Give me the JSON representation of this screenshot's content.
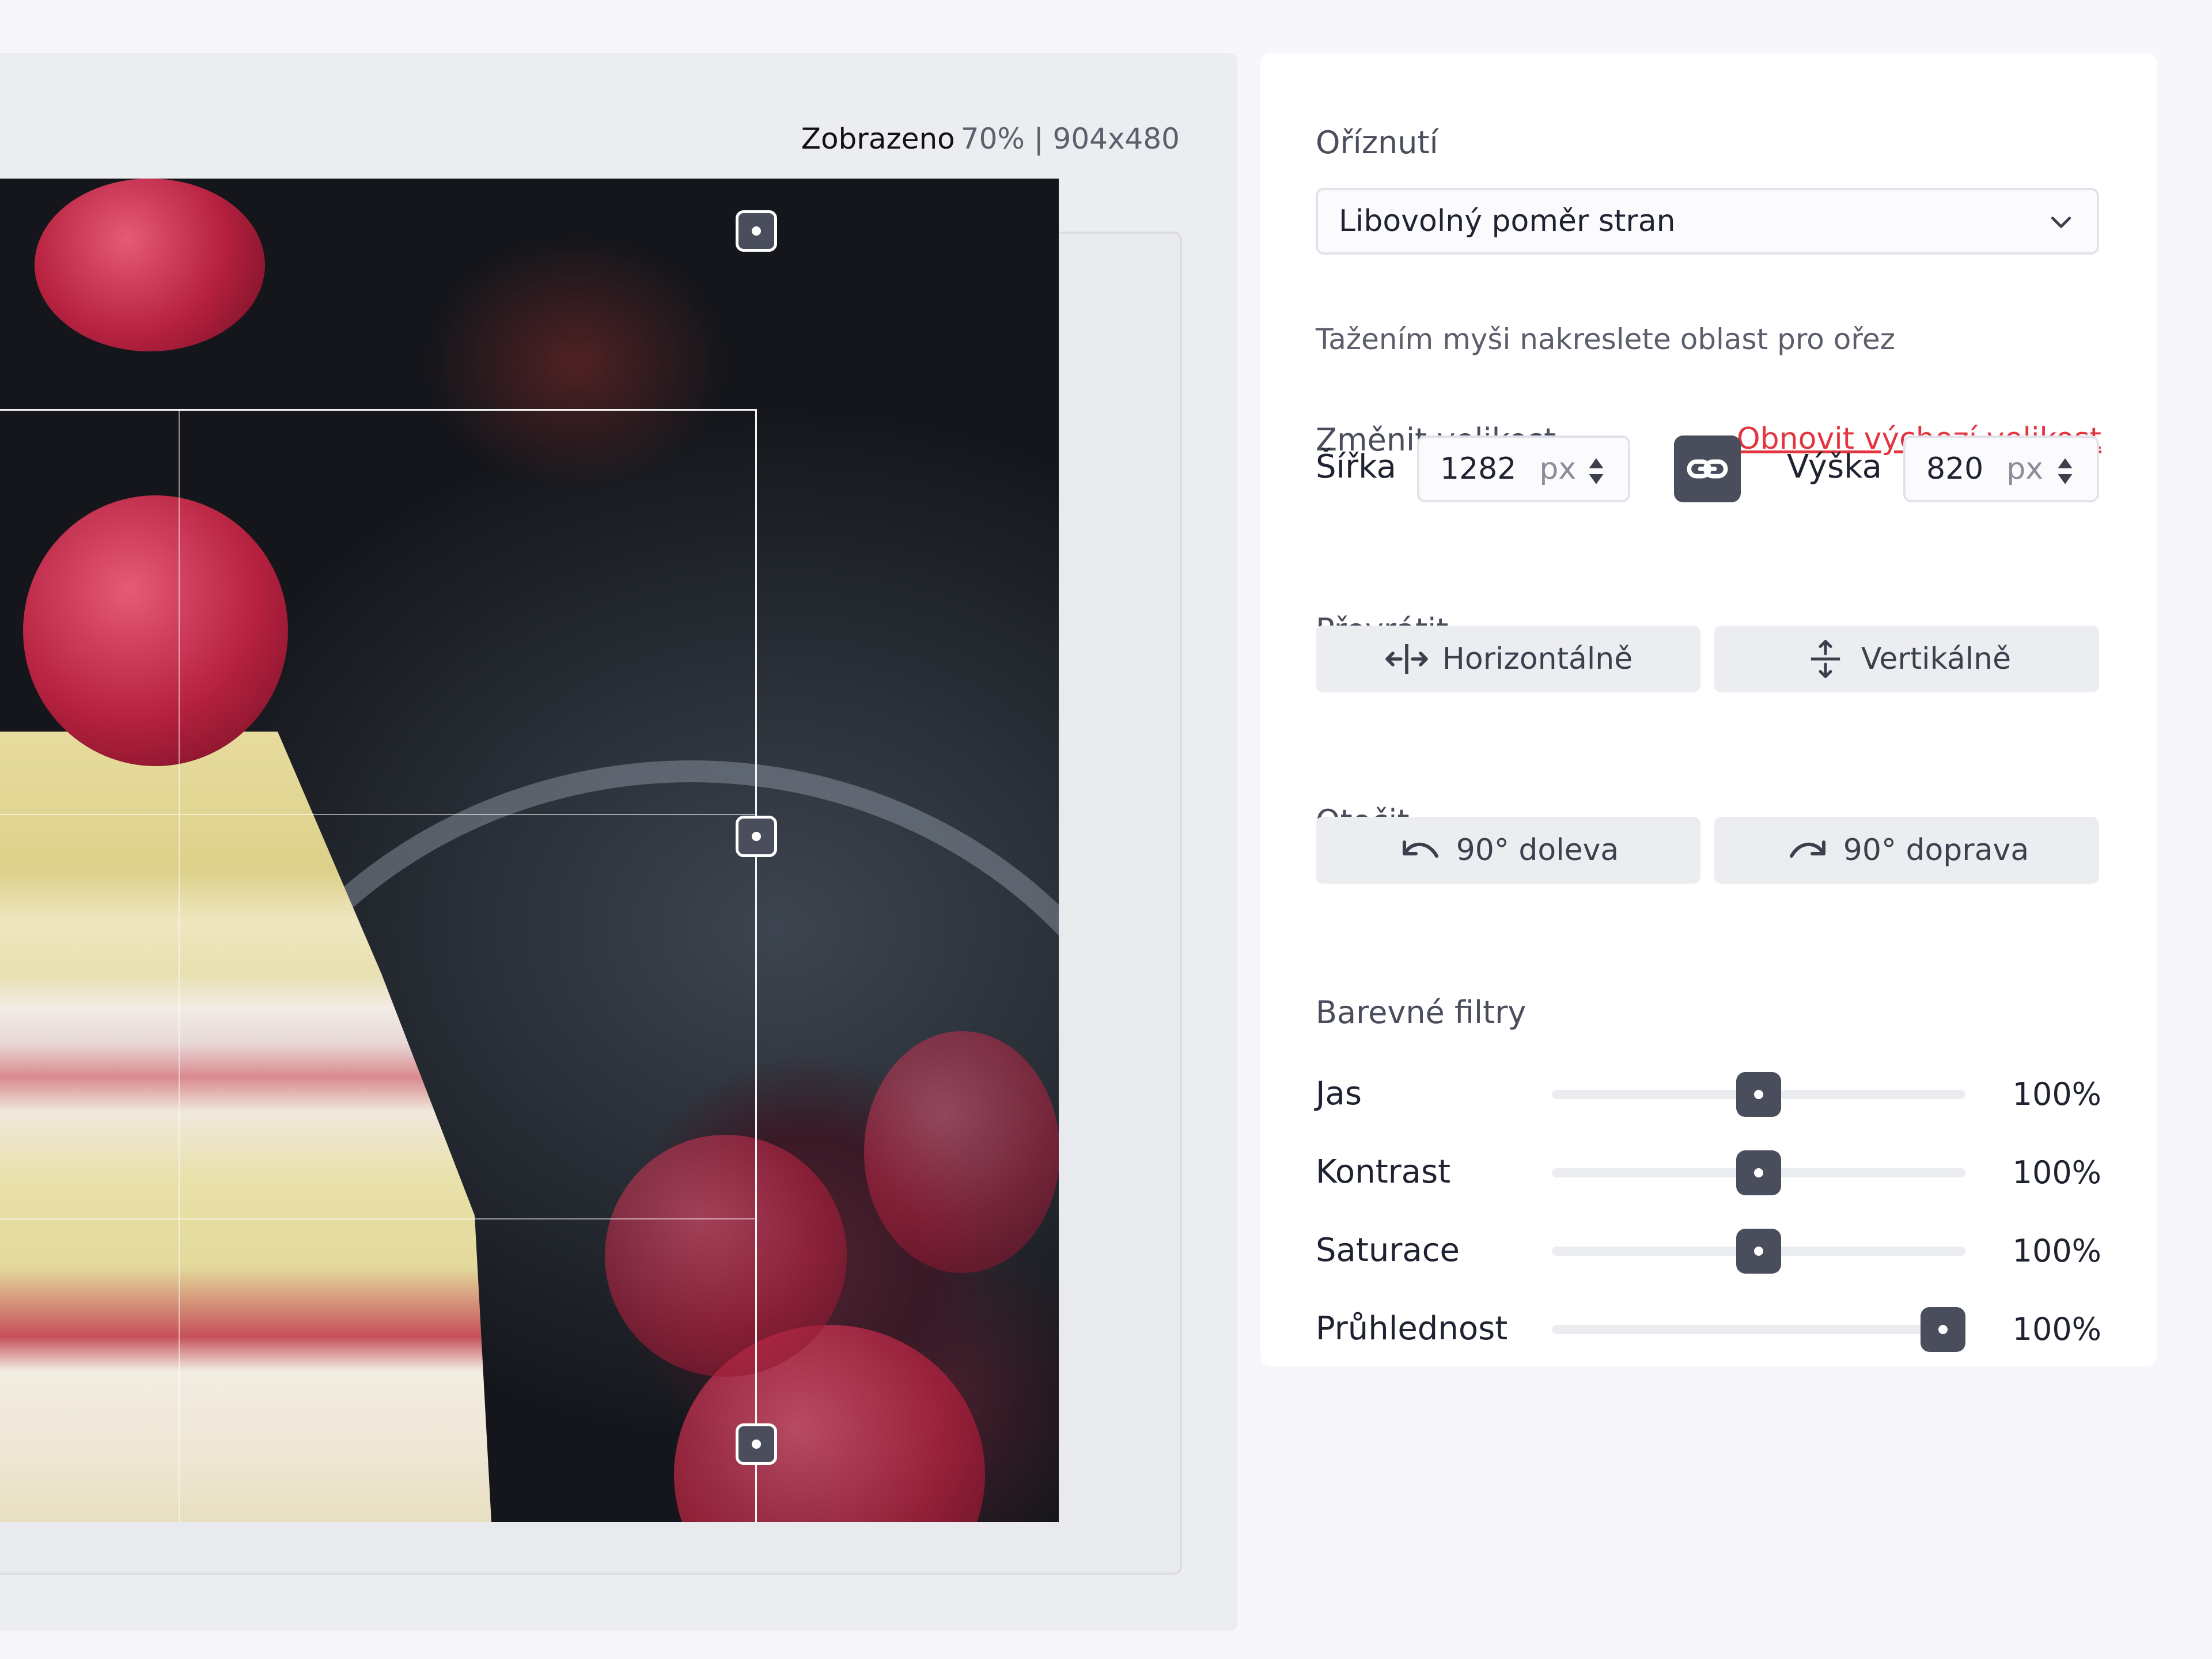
{
  "canvas": {
    "zoom_label": "Zobrazeno",
    "zoom_value": "70% | 904x480"
  },
  "crop": {
    "title": "Oříznutí",
    "aspect_selected": "Libovolný poměr stran",
    "hint": "Tažením myši nakreslete oblast pro ořez"
  },
  "resize": {
    "title": "Změnit velikost",
    "reset_label": "Obnovit výchozí velikost",
    "width_label": "Šířka",
    "width_value": "1282",
    "height_label": "Výška",
    "height_value": "820",
    "unit": "px",
    "lock_icon": "link-icon"
  },
  "flip": {
    "title": "Převrátit",
    "horizontal_label": "Horizontálně",
    "vertical_label": "Vertikálně"
  },
  "rotate": {
    "title": "Otočit",
    "left_label": "90° doleva",
    "right_label": "90° doprava"
  },
  "filters": {
    "title": "Barevné filtry",
    "items": [
      {
        "label": "Jas",
        "value_text": "100%",
        "level": 0.5
      },
      {
        "label": "Kontrast",
        "value_text": "100%",
        "level": 0.5
      },
      {
        "label": "Saturace",
        "value_text": "100%",
        "level": 0.5
      },
      {
        "label": "Průhlednost",
        "value_text": "100%",
        "level": 1.0
      }
    ]
  },
  "colors": {
    "accent": "#4a4d5c",
    "link": "#e3343f",
    "panel_bg": "#ffffff",
    "canvas_bg": "#ecedf1"
  }
}
